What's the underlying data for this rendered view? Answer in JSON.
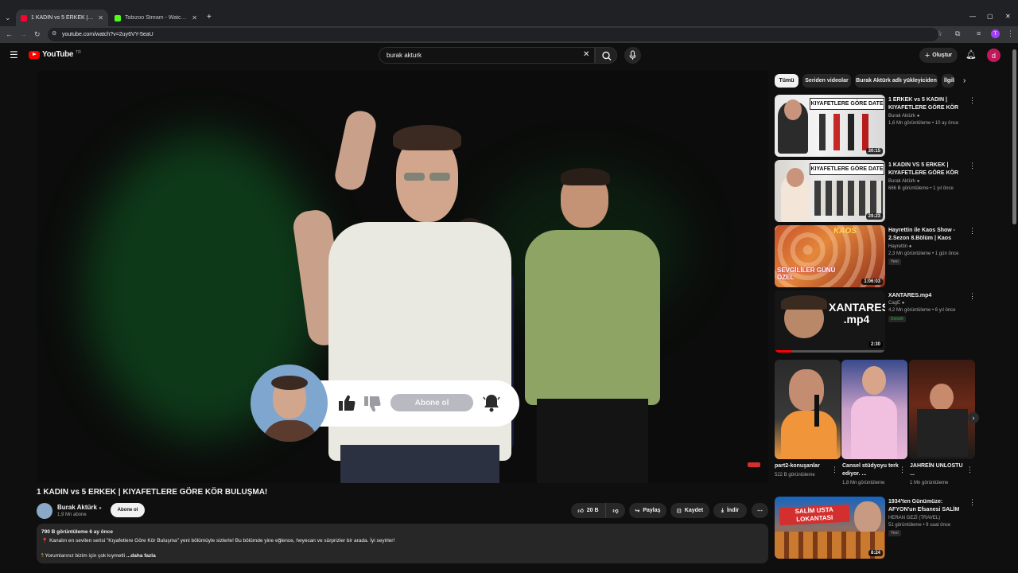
{
  "browser": {
    "tabs": [
      {
        "title": "1 KADIN vs 5 ERKEK | KIYAFETLERE GÖRE KÖR BULUŞMA!",
        "favicon_color": "#ff0033",
        "active": true
      },
      {
        "title": "Tobizoo Stream - Watch Live on Kick",
        "favicon_color": "#53fc18",
        "active": false
      }
    ],
    "new_tab": "+",
    "url": "youtube.com/watch?v=2uy6VY-5eaU",
    "profile_initial": "T"
  },
  "header": {
    "logo_text": "YouTube",
    "country_code": "TR",
    "search_value": "burak akturk",
    "create_label": "Oluştur",
    "avatar_initial": "d"
  },
  "player": {
    "subscribe_overlay_label": "Abone ol"
  },
  "video": {
    "title": "1 KADIN vs 5 ERKEK | KIYAFETLERE GÖRE KÖR BULUŞMA!",
    "channel_name": "Burak Aktürk",
    "subscriber_count": "1,9 Mn abone",
    "subscribe_label": "Abone ol",
    "like_count": "20 B",
    "share_label": "Paylaş",
    "save_label": "Kaydet",
    "download_label": "İndir",
    "views_date": "790 B görüntüleme  6 ay önce",
    "description_line": "Kanalın en sevilen serisi \"Kıyafetlere Göre Kör Buluşma\" yeni bölümüyle sizlerle! Bu bölümde yine eğlence, heyecan ve sürprizler bir arada. İyi seyirler!",
    "description_line2": "Yorumlarınız bizim için çok kıymetli",
    "more_label": "...daha fazla"
  },
  "sidebar": {
    "chips": [
      "Tümü",
      "Seriden videolar",
      "Burak Aktürk adlı yükleyiciden",
      "İlgili"
    ],
    "recommendations": [
      {
        "title": "1 ERKEK vs 5 KADIN | KIYAFETLERE GÖRE KÖR BULUŞMA!",
        "channel": "Burak Aktürk",
        "meta": "1,6 Mn görüntüleme • 10 ay önce",
        "duration": "30:15",
        "overlay": "KIYAFETLERE GÖRE DATE",
        "verified": true,
        "badge": ""
      },
      {
        "title": "1 KADIN VS 5 ERKEK | KIYAFETLERE GÖRE KÖR BULUŞMA!",
        "channel": "Burak Aktürk",
        "meta": "686 B görüntüleme • 1 yıl önce",
        "duration": "29:23",
        "overlay": "KIYAFETLERE GÖRE DATE",
        "verified": true,
        "badge": ""
      },
      {
        "title": "Hayrettin ile Kaos Show - 2.Sezon 8.Bölüm | Kaos Show",
        "channel": "Hayrettin",
        "meta": "2,3 Mn görüntüleme • 1 gün önce",
        "duration": "1:06:03",
        "overlay": "SEVGİLİLER GÜNÜ ÖZEL",
        "verified": true,
        "badge": "Yeni"
      },
      {
        "title": "XANTARES.mp4",
        "channel": "CagE",
        "meta": "4,2 Mn görüntüleme • 6 yıl önce",
        "duration": "2:30",
        "overlay": "XANTARES .mp4",
        "verified": true,
        "badge": "Denetli"
      }
    ],
    "shorts": [
      {
        "title": "part2-konuşanlar",
        "views": "522 B görüntüleme"
      },
      {
        "title": "Cansel stüdyoyu terk ediyor. ...",
        "views": "1,8 Mn görüntüleme"
      },
      {
        "title": "JAHREİN UNLOSTU ...",
        "views": "1 Mn görüntüleme"
      }
    ],
    "last_rec": {
      "title": "1934'ten Günümüze: AFYON'un Efsanesi SALİM USTA",
      "channel": "HERAN GEZİ (TRAVEL)",
      "meta": "51 görüntüleme • 9 saat önce",
      "duration": "8:24",
      "overlay": "SALİM USTA LOKANTASI",
      "badge": "Yeni"
    }
  }
}
